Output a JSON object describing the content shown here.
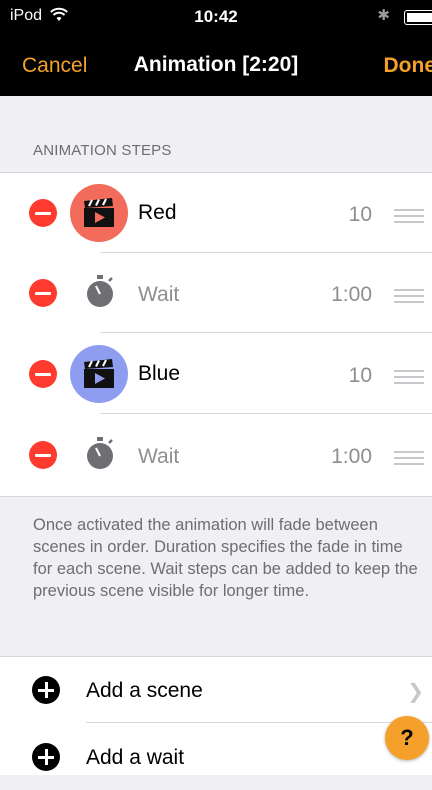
{
  "status_bar": {
    "device": "iPod",
    "time": "10:42",
    "wifi_icon": "wifi-icon",
    "bluetooth_icon": "bluetooth-icon",
    "battery_level": 0.9
  },
  "nav": {
    "cancel_label": "Cancel",
    "title": "Animation [2:20]",
    "done_label": "Done"
  },
  "section_header": "ANIMATION STEPS",
  "steps": [
    {
      "type": "scene",
      "label": "Red",
      "value": "10",
      "color": "#f26b5b",
      "icon": "clapperboard-icon"
    },
    {
      "type": "wait",
      "label": "Wait",
      "value": "1:00",
      "icon": "stopwatch-icon"
    },
    {
      "type": "scene",
      "label": "Blue",
      "value": "10",
      "color": "#8f9df0",
      "icon": "clapperboard-icon"
    },
    {
      "type": "wait",
      "label": "Wait",
      "value": "1:00",
      "icon": "stopwatch-icon"
    }
  ],
  "footer_text": "Once activated the animation will fade between scenes in order. Duration specifies the fade in time for each scene. Wait steps can be added to keep the previous scene visible for longer time.",
  "add_actions": [
    {
      "label": "Add a scene",
      "icon": "plus-circle-icon"
    },
    {
      "label": "Add a wait",
      "icon": "plus-circle-icon"
    }
  ],
  "help_button": {
    "label": "?"
  },
  "colors": {
    "accent": "#f5a02a",
    "delete": "#ff3b30",
    "background": "#efeff4"
  }
}
